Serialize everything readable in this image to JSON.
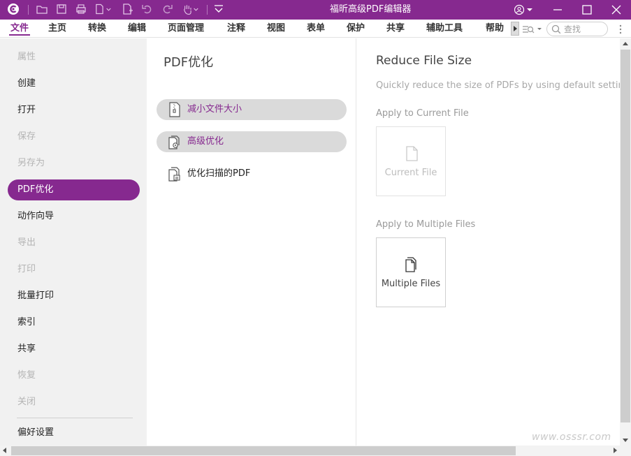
{
  "titlebar": {
    "title": "福昕高级PDF编辑器",
    "accent": "#86298f",
    "quick_access_icons": [
      "app-logo-icon",
      "open-folder-icon",
      "save-icon",
      "print-icon",
      "new-file-icon",
      "new-page-icon",
      "undo-icon",
      "redo-icon",
      "hand-tool-icon",
      "customize-dropdown-icon"
    ],
    "window_controls": [
      "account-icon",
      "minimize-icon",
      "maximize-icon",
      "close-icon"
    ]
  },
  "menubar": {
    "items": [
      {
        "label": "文件",
        "active": true
      },
      {
        "label": "主页"
      },
      {
        "label": "转换"
      },
      {
        "label": "编辑"
      },
      {
        "label": "页面管理"
      },
      {
        "label": "注释"
      },
      {
        "label": "视图"
      },
      {
        "label": "表单"
      },
      {
        "label": "保护"
      },
      {
        "label": "共享"
      },
      {
        "label": "辅助工具"
      },
      {
        "label": "帮助"
      }
    ],
    "search_placeholder": "查找"
  },
  "sidebar": {
    "items": [
      {
        "label": "属性",
        "disabled": true
      },
      {
        "label": "创建"
      },
      {
        "label": "打开"
      },
      {
        "label": "保存",
        "disabled": true
      },
      {
        "label": "另存为",
        "disabled": true
      },
      {
        "label": "PDF优化",
        "active": true
      },
      {
        "label": "动作向导"
      },
      {
        "label": "导出",
        "disabled": true
      },
      {
        "label": "打印",
        "disabled": true
      },
      {
        "label": "批量打印"
      },
      {
        "label": "索引"
      },
      {
        "label": "共享"
      },
      {
        "label": "恢复",
        "disabled": true
      },
      {
        "label": "关闭",
        "disabled": true
      }
    ],
    "footer_item": "偏好设置"
  },
  "middle": {
    "title": "PDF优化",
    "options": [
      {
        "label": "减小文件大小",
        "state": "selected"
      },
      {
        "label": "高级优化",
        "state": "hovered"
      },
      {
        "label": "优化扫描的PDF",
        "state": "normal"
      }
    ]
  },
  "right": {
    "title": "Reduce File Size",
    "description": "Quickly reduce the size of PDFs by using default settings",
    "current_section": "Apply to Current File",
    "current_tile": "Current File",
    "multiple_section": "Apply to Multiple Files",
    "multiple_tile": "Multiple Files"
  },
  "watermark": "www.osssr.com"
}
